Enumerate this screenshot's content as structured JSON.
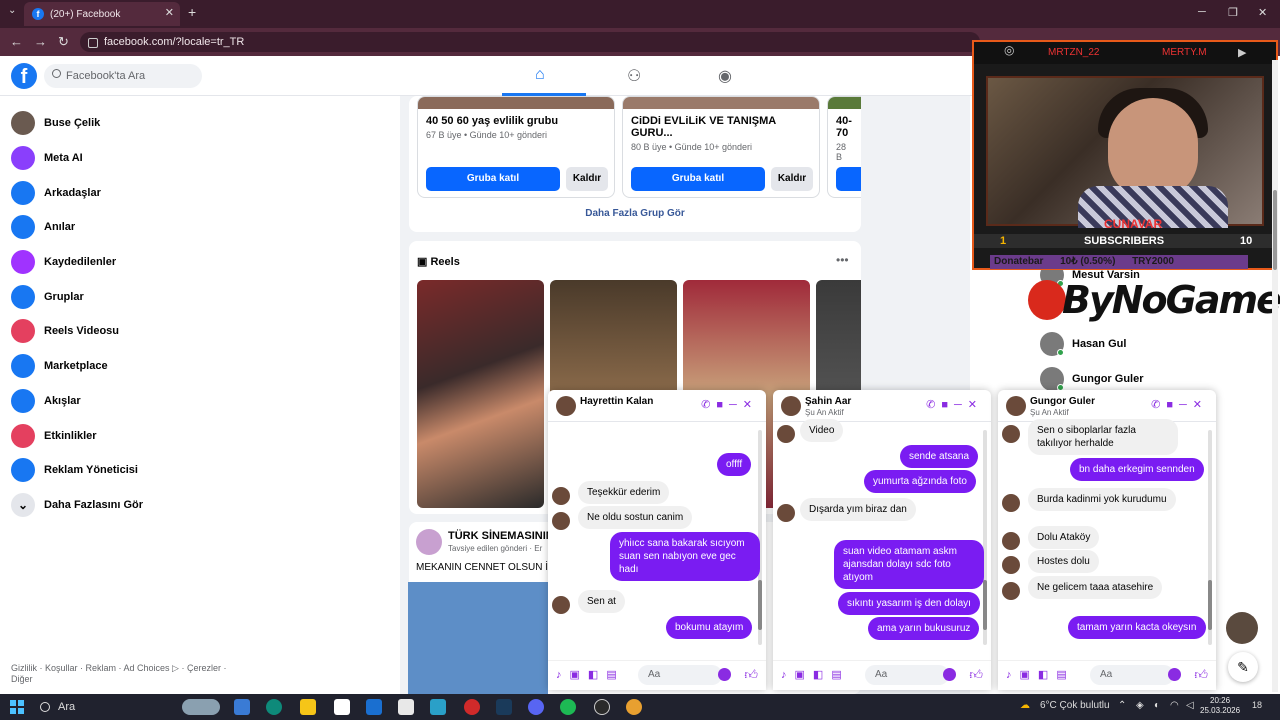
{
  "browser": {
    "tab_title": "(20+) Facebook",
    "url": "facebook.com/?locale=tr_TR",
    "new_tab": "+",
    "close": "✕"
  },
  "header": {
    "logo": "f",
    "search_placeholder": "Facebook'ta Ara"
  },
  "sidebar": {
    "items": [
      {
        "label": "Buse Çelik",
        "color": "#6a5a50",
        "icon": "avatar-icon"
      },
      {
        "label": "Meta AI",
        "color": "#8a3ffc",
        "icon": "meta-ai-icon"
      },
      {
        "label": "Arkadaşlar",
        "color": "#1877f2",
        "icon": "friends-icon"
      },
      {
        "label": "Anılar",
        "color": "#1877f2",
        "icon": "memories-icon"
      },
      {
        "label": "Kaydedilenler",
        "color": "#a033ff",
        "icon": "saved-icon"
      },
      {
        "label": "Gruplar",
        "color": "#1877f2",
        "icon": "groups-icon"
      },
      {
        "label": "Reels Videosu",
        "color": "#e4405f",
        "icon": "reels-icon"
      },
      {
        "label": "Marketplace",
        "color": "#1877f2",
        "icon": "marketplace-icon"
      },
      {
        "label": "Akışlar",
        "color": "#1877f2",
        "icon": "feeds-icon"
      },
      {
        "label": "Etkinlikler",
        "color": "#e4405f",
        "icon": "events-icon"
      },
      {
        "label": "Reklam Yöneticisi",
        "color": "#1877f2",
        "icon": "ads-manager-icon"
      },
      {
        "label": "Daha Fazlasını Gör",
        "color": "#e4e6eb",
        "icon": "chevron-down-icon"
      }
    ],
    "footer": "Gizlilik · Koşullar · Reklam · Ad Choices ▷ · Çerezler · Diğer"
  },
  "groups": [
    {
      "name": "40 50 60 yaş evlilik grubu",
      "meta": "67 B üye • Günde 10+ gönderi",
      "join": "Gruba katıl",
      "remove": "Kaldır"
    },
    {
      "name": "CiDDi EVLiLiK VE TANIŞMA GURU...",
      "meta": "80 B üye • Günde 10+ gönderi",
      "join": "Gruba katıl",
      "remove": "Kaldır"
    },
    {
      "name": "40-70",
      "meta": "28 B",
      "join": "",
      "remove": ""
    }
  ],
  "more_groups": "Daha Fazla Grup Gör",
  "reels": {
    "title": "Reels"
  },
  "post": {
    "name": "TÜRK SİNEMASININ İ",
    "sub": "Tavsiye edilen gönderi · Er",
    "text": "MEKANIN  CENNET OLSUN  İ"
  },
  "stream": {
    "top_left": "MRTZN_22",
    "top_right": "MERTY.M",
    "cam_name": "CUNAVAR",
    "subs_left": "1",
    "subs_label": "SUBSCRIBERS",
    "subs_right": "10",
    "donate": "Donatebar      10₺ (0.50%)      TRY2000",
    "brand": "ByNoGame"
  },
  "contacts": [
    {
      "name": "Mesut Varsin"
    },
    {
      "name": "Hasan Gul"
    },
    {
      "name": "Gungor Guler"
    }
  ],
  "chats": [
    {
      "name": "Hayrettin Kalan",
      "status": "",
      "input": "Aa",
      "messages": [
        {
          "dir": "out",
          "text": "offff"
        },
        {
          "dir": "in",
          "text": "Teşekkür ederim"
        },
        {
          "dir": "in",
          "text": "Ne oldu sostun canim"
        },
        {
          "dir": "out",
          "text": "yhiıcc sana bakarak sıcıyom suan sen nabıyon eve gec hadı"
        },
        {
          "dir": "in",
          "text": "Sen at"
        },
        {
          "dir": "out",
          "text": "bokumu atayım"
        }
      ]
    },
    {
      "name": "Şahin Aar",
      "status": "Şu An Aktif",
      "input": "Aa",
      "messages": [
        {
          "dir": "in",
          "text": "Video"
        },
        {
          "dir": "out",
          "text": "sende atsana"
        },
        {
          "dir": "out",
          "text": "yumurta ağzında foto"
        },
        {
          "dir": "in",
          "text": "Dışarda yım  biraz dan"
        },
        {
          "dir": "out",
          "text": "suan video atamam askm ajansdan dolayı sdc foto atıyom"
        },
        {
          "dir": "out",
          "text": "sıkıntı yasarım iş den dolayı"
        },
        {
          "dir": "out",
          "text": "ama yarın bukusuruz"
        }
      ]
    },
    {
      "name": "Gungor Guler",
      "status": "Şu An Aktif",
      "input": "Aa",
      "messages": [
        {
          "dir": "in",
          "text": "Sen o siboplarlar fazla takılıyor herhalde"
        },
        {
          "dir": "out",
          "text": "bn daha erkegim sennden"
        },
        {
          "dir": "in",
          "text": "Burda kadinmi yok kurudumu"
        },
        {
          "dir": "in",
          "text": "Dolu Ataköy"
        },
        {
          "dir": "in",
          "text": "Hostes dolu"
        },
        {
          "dir": "in",
          "text": "Ne gelicem taaa atasehire"
        },
        {
          "dir": "out",
          "text": "tamam yarın kacta okeysın"
        }
      ]
    }
  ],
  "taskbar": {
    "search": "Ara",
    "weather": "6°C  Çok bulutlu",
    "time": "20:26",
    "date": "25.03.2026",
    "notif": "18"
  }
}
